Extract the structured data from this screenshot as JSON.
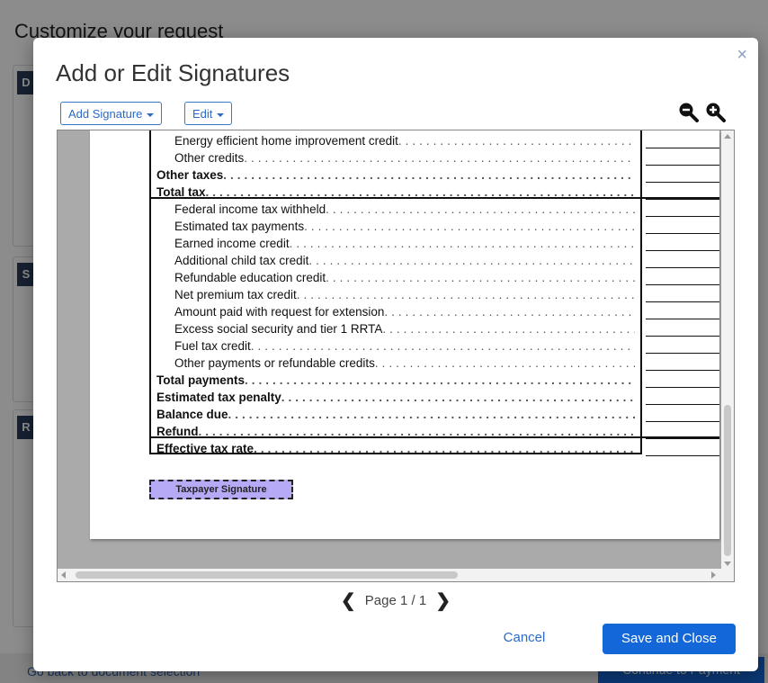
{
  "background": {
    "page_title": "Customize your request",
    "card_tags": [
      "D",
      "S",
      "R"
    ],
    "back_link": "Go back to document selection",
    "continue_button": "Continue to Payment"
  },
  "modal": {
    "title": "Add or Edit Signatures",
    "close_label": "×",
    "toolbar": {
      "add_signature_label": "Add Signature",
      "edit_label": "Edit"
    },
    "zoom": {
      "zoom_out_icon": "zoom-out-icon",
      "zoom_in_icon": "zoom-in-icon"
    },
    "document": {
      "rows": [
        {
          "label": "Energy efficient home improvement credit",
          "bold": false,
          "indent": true
        },
        {
          "label": "Other credits",
          "bold": false,
          "indent": true
        },
        {
          "label": "Other taxes",
          "bold": true,
          "indent": false
        },
        {
          "label": "Total tax",
          "bold": true,
          "indent": false
        },
        {
          "label": "Federal income tax withheld",
          "bold": false,
          "indent": true
        },
        {
          "label": "Estimated tax payments",
          "bold": false,
          "indent": true
        },
        {
          "label": "Earned income credit",
          "bold": false,
          "indent": true
        },
        {
          "label": "Additional child tax credit",
          "bold": false,
          "indent": true
        },
        {
          "label": "Refundable education credit",
          "bold": false,
          "indent": true
        },
        {
          "label": "Net premium tax credit",
          "bold": false,
          "indent": true
        },
        {
          "label": "Amount paid with request for extension",
          "bold": false,
          "indent": true
        },
        {
          "label": "Excess social security and tier 1 RRTA",
          "bold": false,
          "indent": true
        },
        {
          "label": "Fuel tax credit",
          "bold": false,
          "indent": true
        },
        {
          "label": "Other payments or refundable credits",
          "bold": false,
          "indent": true
        },
        {
          "label": "Total payments",
          "bold": true,
          "indent": false
        },
        {
          "label": "Estimated tax penalty",
          "bold": true,
          "indent": false
        },
        {
          "label": "Balance due",
          "bold": true,
          "indent": false
        },
        {
          "label": "Refund",
          "bold": true,
          "indent": false
        },
        {
          "label": "Effective tax rate",
          "bold": true,
          "indent": false
        }
      ],
      "signature_field_label": "Taxpayer Signature"
    },
    "pagination": {
      "text": "Page 1 / 1",
      "prev": "❮",
      "next": "❯"
    },
    "cancel_label": "Cancel",
    "save_label": "Save and Close"
  },
  "colors": {
    "accent": "#1467d8",
    "signature_field": "#b6aaf6"
  }
}
